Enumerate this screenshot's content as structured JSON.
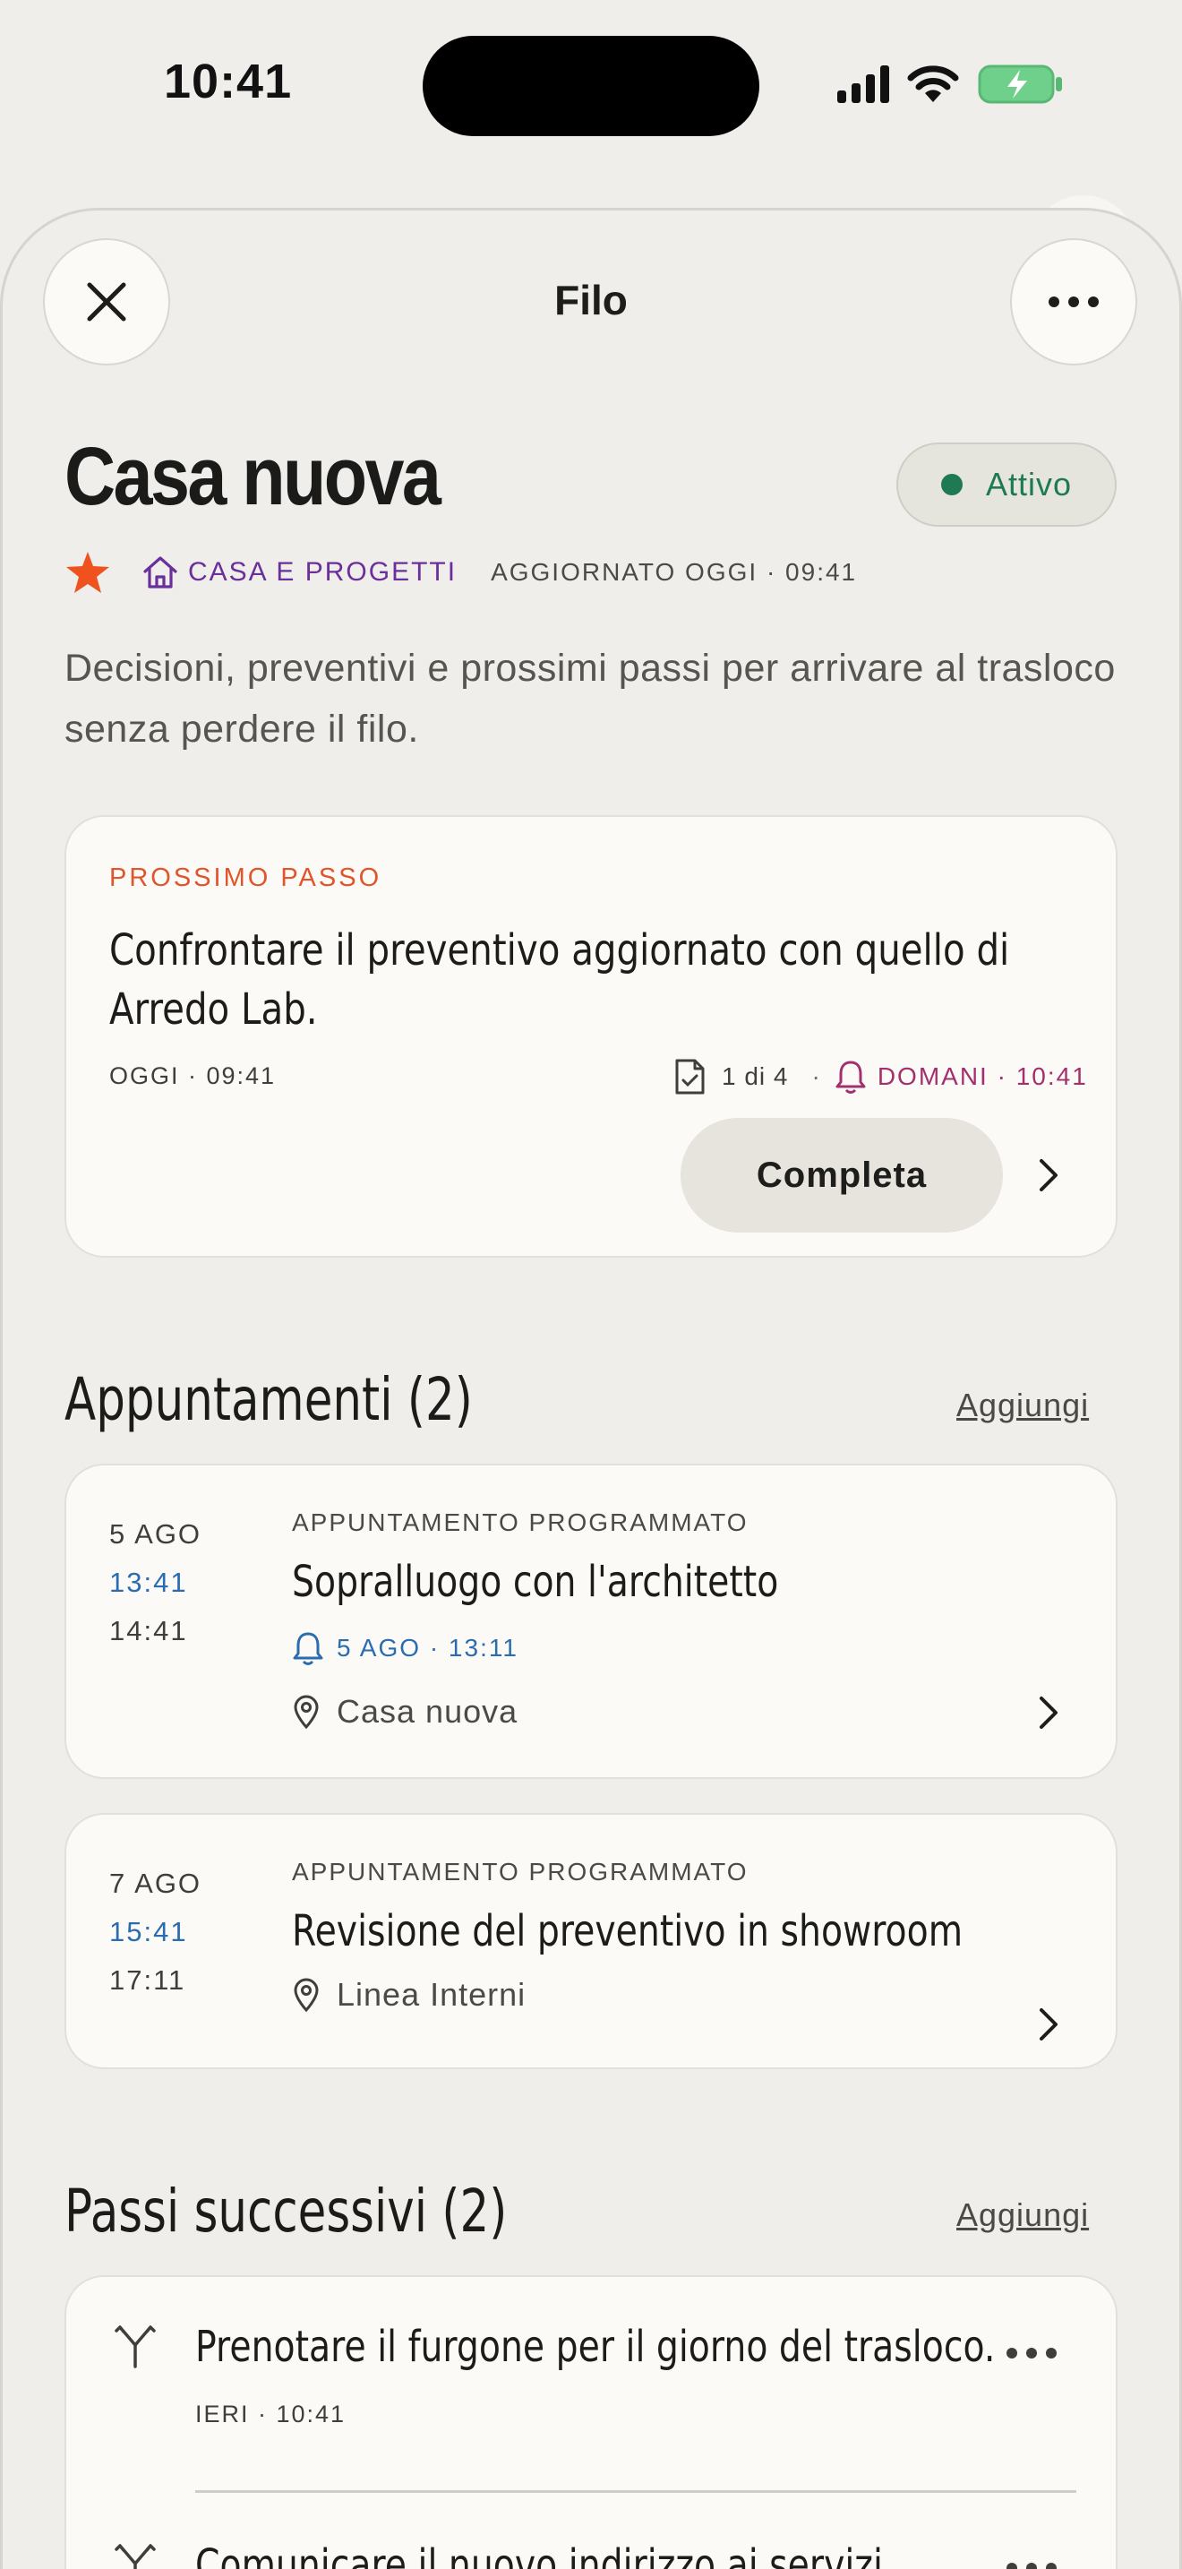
{
  "status_bar": {
    "time": "10:41"
  },
  "nav": {
    "title": "Filo"
  },
  "thread": {
    "title": "Casa nuova",
    "status": "Attivo",
    "category": "CASA E PROGETTI",
    "updated": "AGGIORNATO OGGI · 09:41",
    "description": "Decisioni, preventivi e prossimi passi per arrivare al trasloco senza perdere il filo."
  },
  "next_step": {
    "eyebrow": "PROSSIMO PASSO",
    "text": "Confrontare il preventivo aggiornato con quello di Arredo Lab.",
    "date": "OGGI · 09:41",
    "attachments": "1 di 4",
    "separator": "·",
    "reminder": "DOMANI · 10:41",
    "complete_label": "Completa"
  },
  "appointments": {
    "title": "Appuntamenti (2)",
    "add_label": "Aggiungi",
    "items": [
      {
        "day": "5 AGO",
        "start": "13:41",
        "end": "14:41",
        "type": "APPUNTAMENTO PROGRAMMATO",
        "title": "Sopralluogo con l'architetto",
        "reminder": "5 AGO · 13:11",
        "location": "Casa nuova"
      },
      {
        "day": "7 AGO",
        "start": "15:41",
        "end": "17:11",
        "type": "APPUNTAMENTO PROGRAMMATO",
        "title": "Revisione del preventivo in showroom",
        "location": "Linea Interni"
      }
    ]
  },
  "next_steps": {
    "title": "Passi successivi (2)",
    "add_label": "Aggiungi",
    "items": [
      {
        "text": "Prenotare il furgone per il giorno del trasloco.",
        "date": "IERI · 10:41"
      },
      {
        "text": "Comunicare il nuovo indirizzo ai servizi."
      }
    ]
  },
  "colors": {
    "accent_orange": "#e2542a",
    "category_purple": "#6a2f9a",
    "reminder_magenta": "#a3306e",
    "time_blue": "#2b6cb0",
    "status_green": "#1f7a54"
  }
}
